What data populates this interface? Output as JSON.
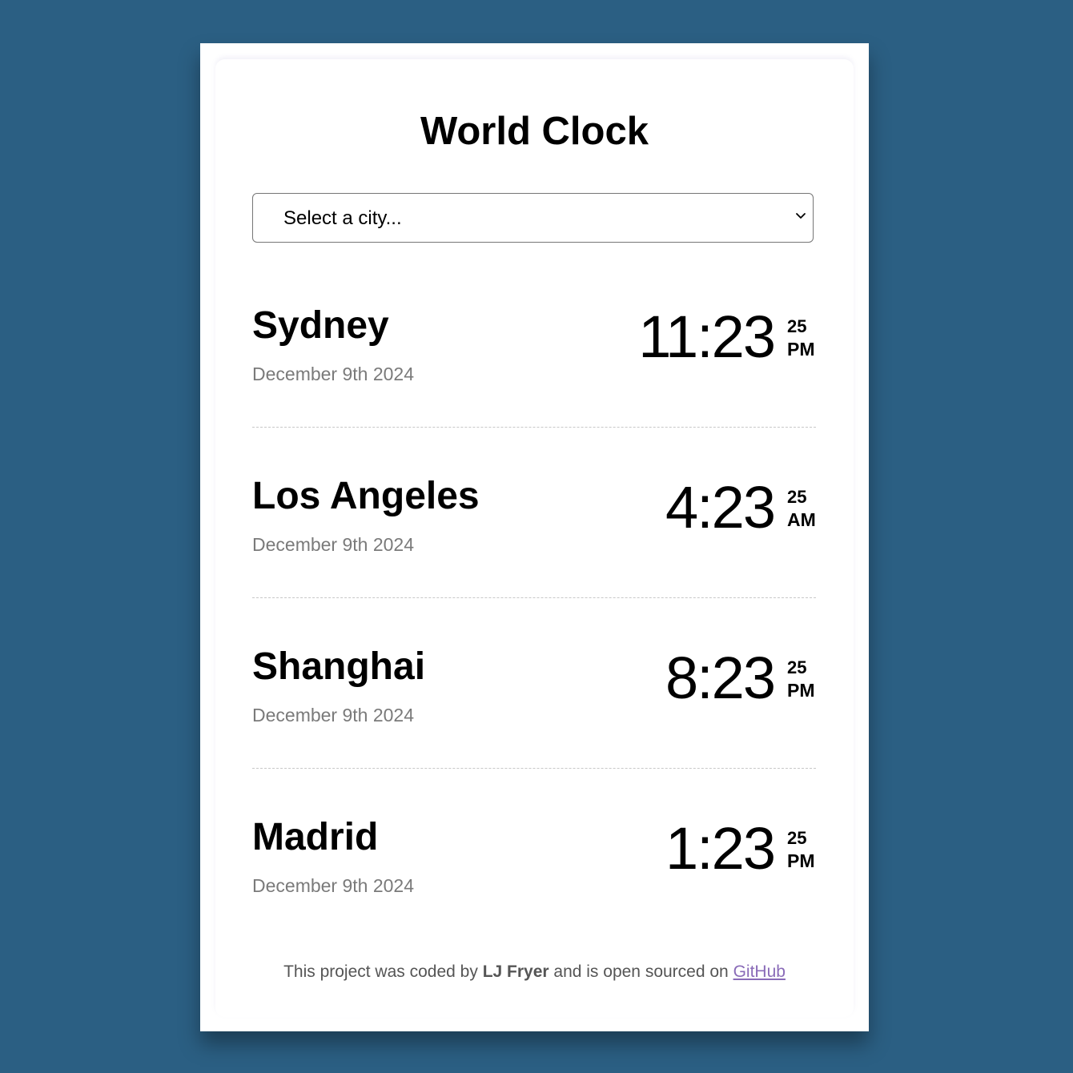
{
  "header": {
    "title": "World Clock"
  },
  "city_select": {
    "placeholder": "Select a city..."
  },
  "cities": [
    {
      "name": "Sydney",
      "date": "December 9th 2024",
      "time": "11:23",
      "seconds": "25",
      "ampm": "PM"
    },
    {
      "name": "Los Angeles",
      "date": "December 9th 2024",
      "time": "4:23",
      "seconds": "25",
      "ampm": "AM"
    },
    {
      "name": "Shanghai",
      "date": "December 9th 2024",
      "time": "8:23",
      "seconds": "25",
      "ampm": "PM"
    },
    {
      "name": "Madrid",
      "date": "December 9th 2024",
      "time": "1:23",
      "seconds": "25",
      "ampm": "PM"
    }
  ],
  "footer": {
    "prefix": "This project was coded by ",
    "author": "LJ Fryer",
    "middle": " and is open sourced on ",
    "link_label": "GitHub"
  },
  "colors": {
    "page_background": "#2b5f83",
    "card_background": "#ffffff",
    "date_text": "#7a7a7a",
    "link": "#8a6bb8"
  }
}
